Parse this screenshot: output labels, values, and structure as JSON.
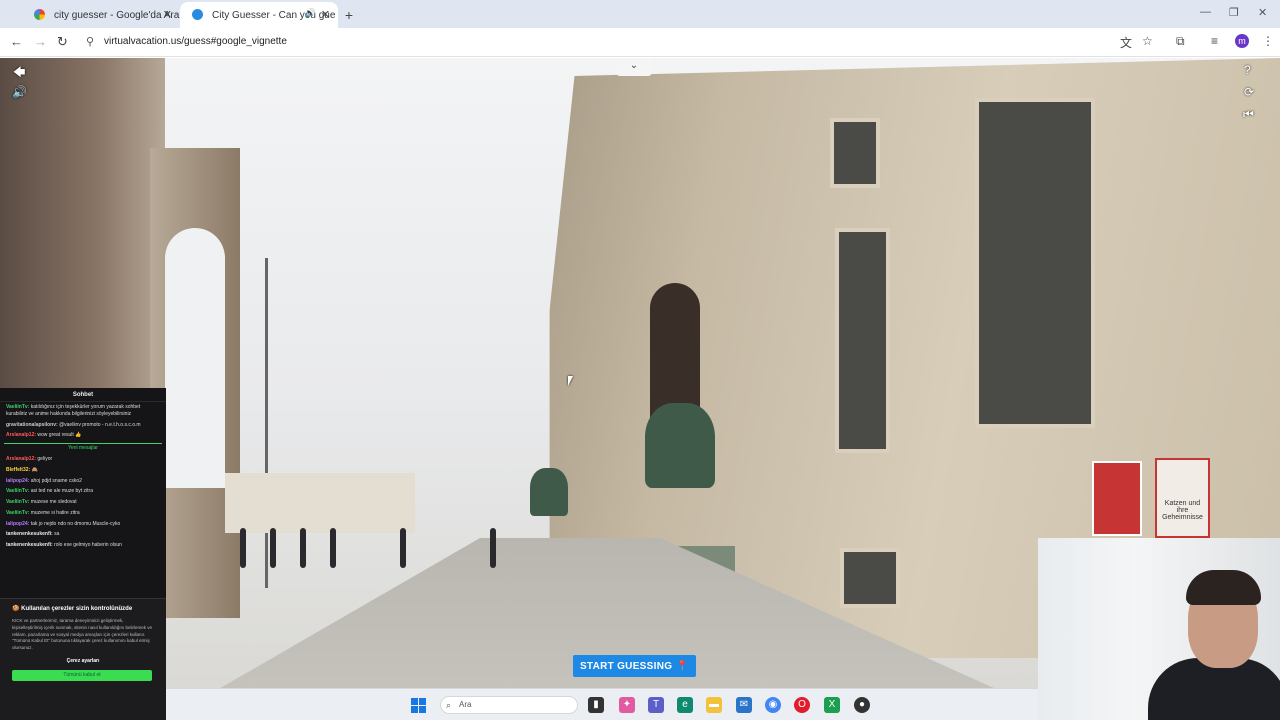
{
  "browser": {
    "tabs": [
      {
        "title": "city guesser - Google'da Ara",
        "active": false
      },
      {
        "title": "City Guesser - Can you gue",
        "active": true
      }
    ],
    "new_tab": "+",
    "url": "virtualvacation.us/guess#google_vignette",
    "profile_initial": "m"
  },
  "game": {
    "start_button": "START GUESSING",
    "poster_text": "Katzen und ihre Geheimnisse"
  },
  "chat": {
    "title": "Sohbet",
    "new_messages_label": "Yeni mesajlar",
    "messages": [
      {
        "user": "VaeliinTv:",
        "text": "katıldığınız için teşekkürler yorum yazarak sohbet kurabiliriz ve anime hakkında bilgilerinizi söyleyebilirsiniz",
        "color": "#3fd36a"
      },
      {
        "user": "gravitationalapsilonv:",
        "text": "@vaeliinv promoto - n.e.t.h.o.s.c.o.m",
        "color": "#c9c9c9"
      },
      {
        "user": "Arslanalp12:",
        "text": "wow great result 👍",
        "color": "#ff5a5a"
      }
    ],
    "new_messages": [
      {
        "user": "Arslanalp12:",
        "text": "geliyor",
        "color": "#ff5a5a"
      },
      {
        "user": "Bleffelt32:",
        "text": "🙈",
        "color": "#ffd23f"
      },
      {
        "user": "lalipop24:",
        "text": "ahoj pdjd sname csko2",
        "color": "#b77bff"
      },
      {
        "user": "VaeliinTv:",
        "text": "asi ted ne ale muze byt zitra",
        "color": "#3fd36a"
      },
      {
        "user": "VaeliinTv:",
        "text": "muzese me sledovat",
        "color": "#3fd36a"
      },
      {
        "user": "VaeliinTv:",
        "text": "muzeme si hatire zitra",
        "color": "#3fd36a"
      },
      {
        "user": "lalipop24:",
        "text": "tak jo nejdo ndo no dmomu Muscle-cyko",
        "color": "#b77bff"
      },
      {
        "user": "tankenenkesukenfi:",
        "text": "sa",
        "color": "#e9e9e9"
      },
      {
        "user": "tankenenkesukenfi:",
        "text": "rolo ese gelmiyo haberin olsun",
        "color": "#e9e9e9"
      }
    ],
    "cookie": {
      "title": "Kullanılan çerezler sizin kontrolünüzde",
      "body": "KICK ve partnerlerimiz, tarama deneyiminizi geliştirmek, kişiselleştirilmiş içerik sunmak, sitenin nasıl kullanıldığını belirlemek ve reklam, pazarlama ve sosyal medya amaçları için çerezleri kullanır. \"Tümünü Kabul Et\" butonuna tıklayarak çerez kullanımını kabul etmiş olursunuz.",
      "settings": "Çerez ayarları",
      "accept": "Tümünü kabul et"
    }
  },
  "taskbar": {
    "search_placeholder": "Ara"
  },
  "colors": {
    "accent": "#1e88e5",
    "chat_green": "#3bdc52",
    "tabbar": "#dfe6f2"
  }
}
